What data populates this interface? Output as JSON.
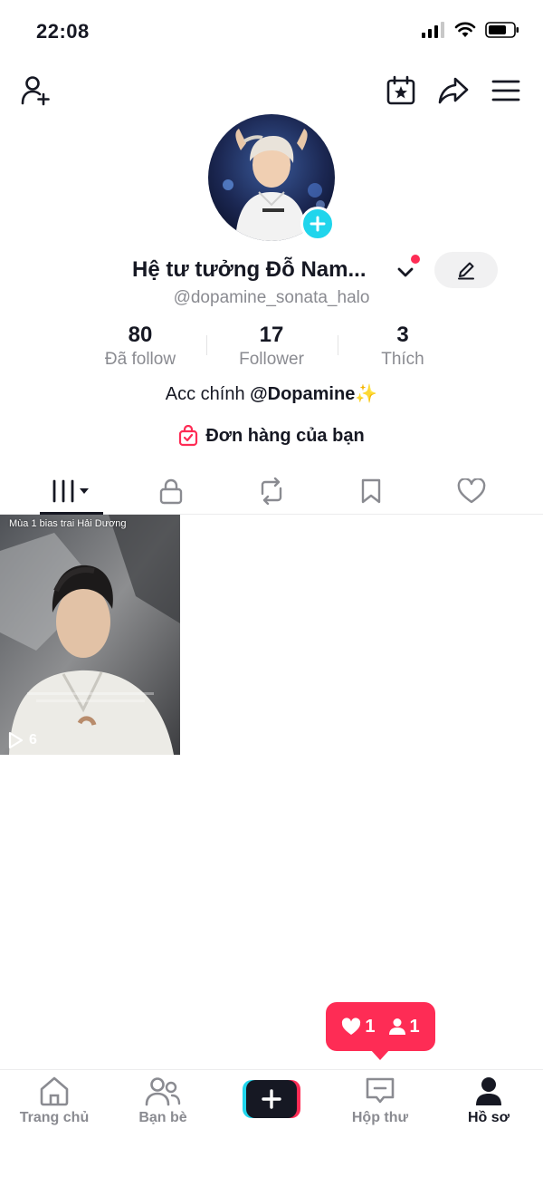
{
  "status_bar": {
    "time": "22:08"
  },
  "profile": {
    "display_name": "Hệ tư tưởng Đỗ Nam...",
    "handle": "@dopamine_sonata_halo",
    "bio_prefix": "Acc chính ",
    "bio_link": "@Dopamine",
    "bio_suffix": "✨",
    "orders_label": "Đơn hàng của bạn"
  },
  "stats": [
    {
      "value": "80",
      "label": "Đã follow"
    },
    {
      "value": "17",
      "label": "Follower"
    },
    {
      "value": "3",
      "label": "Thích"
    }
  ],
  "tabs": [
    {
      "icon": "grid-icon",
      "active": true
    },
    {
      "icon": "lock-icon",
      "active": false
    },
    {
      "icon": "repost-icon",
      "active": false
    },
    {
      "icon": "bookmark-icon",
      "active": false
    },
    {
      "icon": "heart-icon",
      "active": false
    }
  ],
  "videos": [
    {
      "caption": "Mùa 1 bias trai Hải Dương",
      "plays": "6"
    }
  ],
  "notifications": {
    "likes": "1",
    "followers": "1"
  },
  "bottom_nav": [
    {
      "label": "Trang chủ",
      "icon": "home-icon",
      "active": false
    },
    {
      "label": "Bạn bè",
      "icon": "friends-icon",
      "active": false
    },
    {
      "label": "",
      "icon": "plus-icon",
      "active": false
    },
    {
      "label": "Hộp thư",
      "icon": "inbox-icon",
      "active": false
    },
    {
      "label": "Hồ sơ",
      "icon": "profile-icon",
      "active": true
    }
  ],
  "colors": {
    "accent": "#fe2c55",
    "cyan": "#20d5ec",
    "text": "#161823",
    "muted": "#8a8b91"
  }
}
